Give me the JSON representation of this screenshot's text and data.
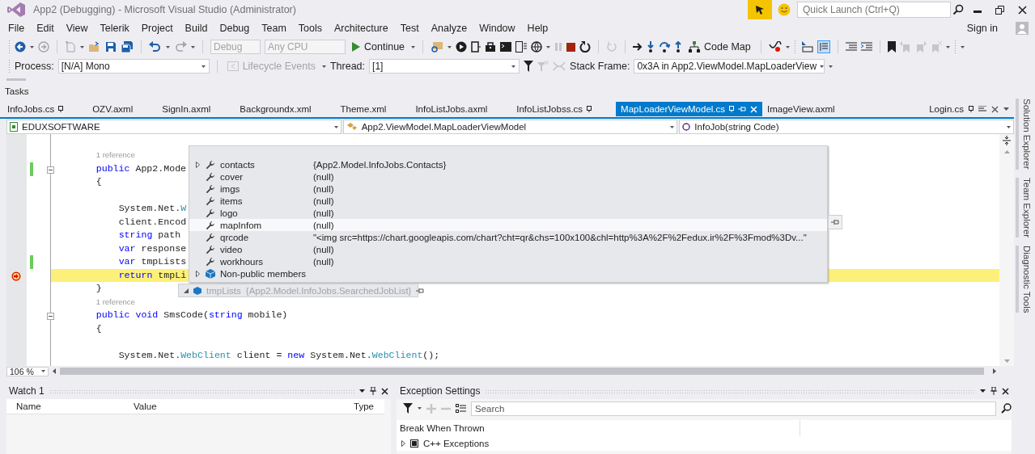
{
  "window": {
    "title": "App2 (Debugging) - Microsoft Visual Studio (Administrator)",
    "quick_launch": {
      "placeholder": "Quick Launch (Ctrl+Q)"
    }
  },
  "menu": [
    "File",
    "Edit",
    "View",
    "Telerik",
    "Project",
    "Build",
    "Debug",
    "Team",
    "Tools",
    "Architecture",
    "Test",
    "Analyze",
    "Window",
    "Help"
  ],
  "sign_in": "Sign in",
  "toolbar": {
    "configuration": {
      "value": "Debug",
      "disabled": true
    },
    "platform": {
      "value": "Any CPU",
      "disabled": true
    },
    "continue": "Continue",
    "code_map": "Code Map"
  },
  "debug_location": {
    "process_label": "Process:",
    "process": "[N/A] Mono",
    "lifecycle": {
      "label": "Lifecycle Events",
      "disabled": true
    },
    "thread_label": "Thread:",
    "thread": "[1]",
    "stack_frame_label": "Stack Frame:",
    "stack_frame": "0x3A in App2.ViewModel.MapLoaderView"
  },
  "tasks_label": "Tasks",
  "tabs": [
    {
      "label": "InfoJobs.cs",
      "selected": false,
      "pinned": true
    },
    {
      "label": "OZV.axml",
      "selected": false,
      "pinned": false
    },
    {
      "label": "SignIn.axml",
      "selected": false,
      "pinned": false
    },
    {
      "label": "Backgroundx.xml",
      "selected": false,
      "pinned": false
    },
    {
      "label": "Theme.xml",
      "selected": false,
      "pinned": false
    },
    {
      "label": "InfoListJobs.axml",
      "selected": false,
      "pinned": false
    },
    {
      "label": "InfoListJobss.cs",
      "selected": false,
      "pinned": true
    },
    {
      "label": "MapLoaderViewModel.cs",
      "selected": true,
      "pinned": true
    },
    {
      "label": "ImageView.axml",
      "selected": false,
      "pinned": false
    }
  ],
  "preview_tab": {
    "label": "Login.cs"
  },
  "navigation": {
    "project": "EDUXSOFTWARE",
    "type": "App2.ViewModel.MapLoaderViewModel",
    "member": "InfoJob(string Code)"
  },
  "editor": {
    "zoom": "106 %",
    "lines": [
      {
        "kind": "codelens",
        "current": false,
        "changed": false,
        "collapsible": false,
        "tokens": [
          {
            "kind": "plain",
            "text": "        1 reference"
          }
        ]
      },
      {
        "kind": "code",
        "current": false,
        "changed": true,
        "collapsible": true,
        "tokens": [
          {
            "kind": "keyword",
            "text": "        public"
          },
          {
            "kind": "plain",
            "text": " App2.Mode"
          }
        ]
      },
      {
        "kind": "code",
        "current": false,
        "changed": false,
        "collapsible": false,
        "tokens": [
          {
            "kind": "plain",
            "text": "        {"
          }
        ]
      },
      {
        "kind": "blank"
      },
      {
        "kind": "code",
        "current": false,
        "changed": false,
        "collapsible": false,
        "tokens": [
          {
            "kind": "plain",
            "text": "            System.Net."
          },
          {
            "kind": "type",
            "text": "W"
          }
        ]
      },
      {
        "kind": "code",
        "current": false,
        "changed": false,
        "collapsible": false,
        "tokens": [
          {
            "kind": "plain",
            "text": "            client.Encod"
          }
        ]
      },
      {
        "kind": "code",
        "current": false,
        "changed": false,
        "collapsible": false,
        "tokens": [
          {
            "kind": "keyword",
            "text": "            string"
          },
          {
            "kind": "plain",
            "text": " path"
          }
        ]
      },
      {
        "kind": "code",
        "current": false,
        "changed": false,
        "collapsible": false,
        "tokens": [
          {
            "kind": "keyword",
            "text": "            var"
          },
          {
            "kind": "plain",
            "text": " response"
          }
        ]
      },
      {
        "kind": "code",
        "current": false,
        "changed": true,
        "collapsible": false,
        "tokens": [
          {
            "kind": "keyword",
            "text": "            var"
          },
          {
            "kind": "plain",
            "text": " tmpLists"
          }
        ]
      },
      {
        "kind": "code",
        "current": true,
        "changed": false,
        "collapsible": false,
        "tokens": [
          {
            "kind": "keyword",
            "text": "            return"
          },
          {
            "kind": "plain",
            "text": " tmpLi"
          }
        ]
      },
      {
        "kind": "code",
        "current": false,
        "changed": false,
        "collapsible": false,
        "tokens": [
          {
            "kind": "plain",
            "text": "        }"
          }
        ]
      },
      {
        "kind": "codelens",
        "current": false,
        "changed": false,
        "collapsible": false,
        "tokens": [
          {
            "kind": "plain",
            "text": "        1 reference"
          }
        ]
      },
      {
        "kind": "code",
        "current": false,
        "changed": false,
        "collapsible": true,
        "tokens": [
          {
            "kind": "keyword",
            "text": "        public void"
          },
          {
            "kind": "plain",
            "text": " SmsCode("
          },
          {
            "kind": "keyword",
            "text": "string"
          },
          {
            "kind": "plain",
            "text": " mobile)"
          }
        ]
      },
      {
        "kind": "code",
        "current": false,
        "changed": false,
        "collapsible": false,
        "tokens": [
          {
            "kind": "plain",
            "text": "        {"
          }
        ]
      },
      {
        "kind": "blank"
      },
      {
        "kind": "code",
        "current": false,
        "changed": false,
        "collapsible": false,
        "tokens": [
          {
            "kind": "plain",
            "text": "            System.Net."
          },
          {
            "kind": "type",
            "text": "WebClient"
          },
          {
            "kind": "plain",
            "text": " client = "
          },
          {
            "kind": "keyword",
            "text": "new"
          },
          {
            "kind": "plain",
            "text": " System.Net."
          },
          {
            "kind": "type",
            "text": "WebClient"
          },
          {
            "kind": "plain",
            "text": "();"
          }
        ]
      }
    ]
  },
  "datatip": {
    "rows": [
      {
        "kind": "property",
        "name": "contacts",
        "value": "{App2.Model.InfoJobs.Contacts}",
        "expandable": true,
        "hovered": false
      },
      {
        "kind": "property",
        "name": "cover",
        "value": "(null)",
        "expandable": false,
        "hovered": false
      },
      {
        "kind": "property",
        "name": "imgs",
        "value": "(null)",
        "expandable": false,
        "hovered": false
      },
      {
        "kind": "property",
        "name": "items",
        "value": "(null)",
        "expandable": false,
        "hovered": false
      },
      {
        "kind": "property",
        "name": "logo",
        "value": "(null)",
        "expandable": false,
        "hovered": false
      },
      {
        "kind": "property",
        "name": "mapInfom",
        "value": "(null)",
        "expandable": false,
        "hovered": true
      },
      {
        "kind": "property",
        "name": "qrcode",
        "value": "\"<img src=https://chart.googleapis.com/chart?cht=qr&chs=100x100&chl=http%3A%2F%2Fedux.ir%2F%3Fmod%3Dv...\"",
        "expandable": false,
        "hovered": false
      },
      {
        "kind": "property",
        "name": "video",
        "value": "(null)",
        "expandable": false,
        "hovered": false
      },
      {
        "kind": "property",
        "name": "workhours",
        "value": "(null)",
        "expandable": false,
        "hovered": false
      },
      {
        "kind": "group",
        "name": "Non-public members",
        "expandable": true,
        "hovered": false
      }
    ],
    "root": {
      "name": "tmpLists",
      "value": "{App2.Model.InfoJobs.SearchedJobList}"
    }
  },
  "side_tabs": [
    "Solution Explorer",
    "Team Explorer",
    "Diagnostic Tools"
  ],
  "watch": {
    "title": "Watch 1",
    "columns": [
      "Name",
      "Value",
      "Type"
    ]
  },
  "exceptions": {
    "title": "Exception Settings",
    "search": {
      "placeholder": "Search"
    },
    "column": "Break When Thrown",
    "rows": [
      {
        "label": "C++ Exceptions",
        "indeterminate": true
      }
    ]
  }
}
